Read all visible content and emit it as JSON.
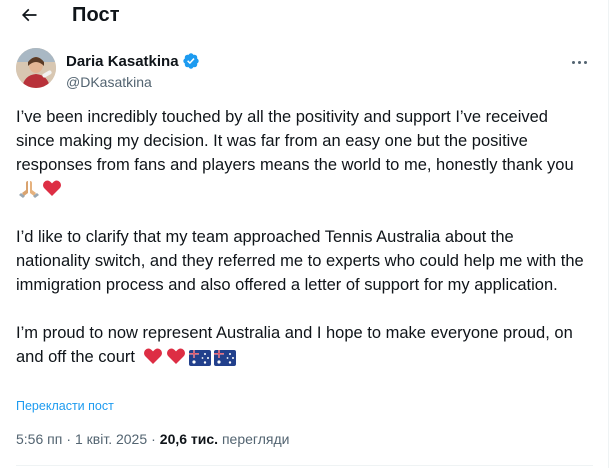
{
  "header": {
    "title": "Пост"
  },
  "tweet": {
    "author": {
      "display_name": "Daria Kasatkina",
      "handle": "@DKasatkina",
      "verified": true
    },
    "paragraphs": [
      {
        "text": "I’ve been incredibly touched by all the positivity and support I’ve received since making my decision. It was far from an easy one but the positive responses from fans and players means the world to me, honestly thank you",
        "emojis": [
          "folded-hands",
          "red-heart"
        ]
      },
      {
        "text": "I’d like to clarify that my team approached Tennis Australia about the nationality switch, and they referred me to experts who could help me with the immigration process and also offered a letter of support for my application.",
        "emojis": []
      },
      {
        "text": "I’m proud to now represent Australia and I hope to make everyone proud, on and off the court",
        "emojis": [
          "red-heart",
          "red-heart",
          "australia-flag",
          "australia-flag"
        ]
      }
    ],
    "translate_label": "Перекласти пост",
    "time": "5:56 пп",
    "separator": "·",
    "date": "1 квіт. 2025",
    "views_count": "20,6 тис.",
    "views_label": "перегляди"
  },
  "colors": {
    "text_primary": "#0f1419",
    "text_secondary": "#536471",
    "link": "#1d9bf0",
    "verified_badge": "#1d9bf0",
    "divider": "#eff3f4"
  },
  "icons": {
    "back": "arrow-left-icon",
    "verified": "verified-badge-icon",
    "more": "more-horizontal-icon"
  }
}
